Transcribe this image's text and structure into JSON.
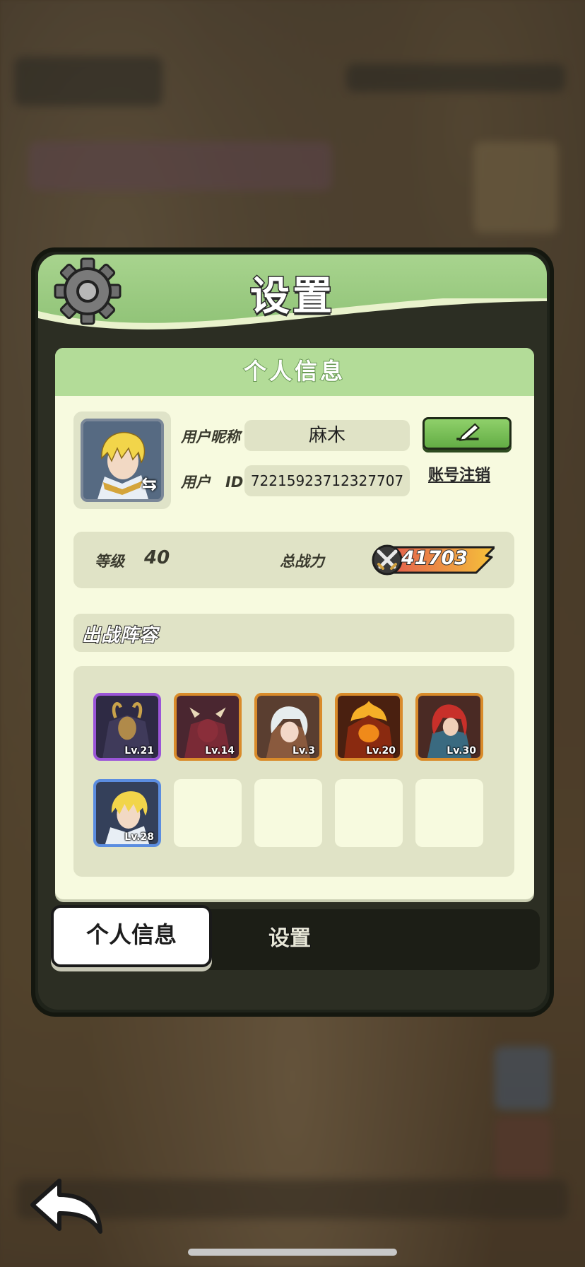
{
  "panel": {
    "title": "设置",
    "card_title": "个人信息"
  },
  "profile": {
    "nickname_label": "用户昵称",
    "nickname": "麻木",
    "id_label": "用户　ID",
    "user_id": "72215923712327707",
    "logout_label": "账号注销"
  },
  "stats": {
    "level_label": "等级",
    "level": "40",
    "power_label": "总战力",
    "power": "41703"
  },
  "lineup": {
    "title": "出战阵容",
    "heroes": [
      {
        "level": "Lv.21",
        "frame": "#9b55d8"
      },
      {
        "level": "Lv.14",
        "frame": "#d98b2a"
      },
      {
        "level": "Lv.3",
        "frame": "#d98b2a"
      },
      {
        "level": "Lv.20",
        "frame": "#d98b2a"
      },
      {
        "level": "Lv.30",
        "frame": "#d98b2a"
      },
      {
        "level": "Lv.28",
        "frame": "#5b8de0"
      }
    ]
  },
  "tabs": {
    "info": "个人信息",
    "settings": "设置"
  },
  "colors": {
    "header_green": "#a8d48e",
    "card_bg": "#f7fadf",
    "edit_green": "#63ad45"
  },
  "icons": [
    "gear-icon",
    "edit-pencil-icon",
    "swap-icon",
    "swords-icon",
    "back-arrow-icon"
  ]
}
